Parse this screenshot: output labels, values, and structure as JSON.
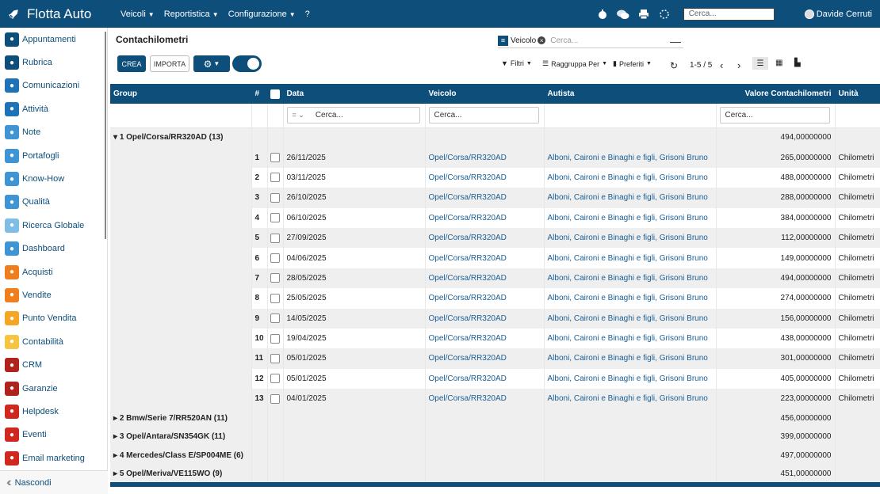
{
  "app": {
    "title": "Flotta Auto"
  },
  "topbar": {
    "menus": [
      {
        "label": "Veicoli"
      },
      {
        "label": "Reportistica"
      },
      {
        "label": "Configurazione"
      },
      {
        "label": "?"
      }
    ],
    "search_placeholder": "Cerca...",
    "user": "Davide Cerruti"
  },
  "sidebar": {
    "items": [
      {
        "label": "Appuntamenti",
        "color": "#0d4e7b",
        "icon": "calendar-icon"
      },
      {
        "label": "Rubrica",
        "color": "#0d4e7b",
        "icon": "contacts-icon"
      },
      {
        "label": "Comunicazioni",
        "color": "#1e73b8",
        "icon": "chat-icon"
      },
      {
        "label": "Attività",
        "color": "#1e73b8",
        "icon": "checkbox-icon"
      },
      {
        "label": "Note",
        "color": "#3f95d3",
        "icon": "note-icon"
      },
      {
        "label": "Portafogli",
        "color": "#3f95d3",
        "icon": "wallet-icon"
      },
      {
        "label": "Know-How",
        "color": "#3f95d3",
        "icon": "lightbulb-icon"
      },
      {
        "label": "Qualità",
        "color": "#3f95d3",
        "icon": "clock-icon"
      },
      {
        "label": "Ricerca Globale",
        "color": "#7fbde6",
        "icon": "search-icon"
      },
      {
        "label": "Dashboard",
        "color": "#3f95d3",
        "icon": "dashboard-icon"
      },
      {
        "label": "Acquisti",
        "color": "#f07e1c",
        "icon": "cart-icon"
      },
      {
        "label": "Vendite",
        "color": "#f07e1c",
        "icon": "chart-icon"
      },
      {
        "label": "Punto Vendita",
        "color": "#f5a623",
        "icon": "register-icon"
      },
      {
        "label": "Contabilità",
        "color": "#f5c542",
        "icon": "ledger-icon"
      },
      {
        "label": "CRM",
        "color": "#b0221c",
        "icon": "handshake-icon"
      },
      {
        "label": "Garanzie",
        "color": "#b0221c",
        "icon": "shield-icon"
      },
      {
        "label": "Helpdesk",
        "color": "#d0281e",
        "icon": "headset-icon"
      },
      {
        "label": "Eventi",
        "color": "#d0281e",
        "icon": "ticket-icon"
      },
      {
        "label": "Email marketing",
        "color": "#d0281e",
        "icon": "send-icon"
      }
    ],
    "hide_label": "Nascondi"
  },
  "control": {
    "title": "Contachilometri",
    "create_label": "CREA",
    "import_label": "IMPORTA",
    "search_facet": "Veicolo",
    "search_placeholder": "Cerca...",
    "filters_label": "Filtri",
    "groupby_label": "Raggruppa Per",
    "favorites_label": "Preferiti",
    "pager": "1-5 / 5"
  },
  "table": {
    "headers": {
      "group": "Group",
      "num": "#",
      "date": "Data",
      "vehicle": "Veicolo",
      "driver": "Autista",
      "value": "Valore Contachilometri",
      "unit": "Unità"
    },
    "filter": {
      "date_op": "=",
      "placeholder": "Cerca..."
    },
    "open_group": {
      "label": "1 Opel/Corsa/RR320AD (13)",
      "total": "494,00000000"
    },
    "rows": [
      {
        "n": "1",
        "date": "26/11/2025",
        "vehicle": "Opel/Corsa/RR320AD",
        "driver": "Alboni, Caironi e Binaghi e figli, Grisoni Bruno",
        "value": "265,00000000",
        "unit": "Chilometri"
      },
      {
        "n": "2",
        "date": "03/11/2025",
        "vehicle": "Opel/Corsa/RR320AD",
        "driver": "Alboni, Caironi e Binaghi e figli, Grisoni Bruno",
        "value": "488,00000000",
        "unit": "Chilometri"
      },
      {
        "n": "3",
        "date": "26/10/2025",
        "vehicle": "Opel/Corsa/RR320AD",
        "driver": "Alboni, Caironi e Binaghi e figli, Grisoni Bruno",
        "value": "288,00000000",
        "unit": "Chilometri"
      },
      {
        "n": "4",
        "date": "06/10/2025",
        "vehicle": "Opel/Corsa/RR320AD",
        "driver": "Alboni, Caironi e Binaghi e figli, Grisoni Bruno",
        "value": "384,00000000",
        "unit": "Chilometri"
      },
      {
        "n": "5",
        "date": "27/09/2025",
        "vehicle": "Opel/Corsa/RR320AD",
        "driver": "Alboni, Caironi e Binaghi e figli, Grisoni Bruno",
        "value": "112,00000000",
        "unit": "Chilometri"
      },
      {
        "n": "6",
        "date": "04/06/2025",
        "vehicle": "Opel/Corsa/RR320AD",
        "driver": "Alboni, Caironi e Binaghi e figli, Grisoni Bruno",
        "value": "149,00000000",
        "unit": "Chilometri"
      },
      {
        "n": "7",
        "date": "28/05/2025",
        "vehicle": "Opel/Corsa/RR320AD",
        "driver": "Alboni, Caironi e Binaghi e figli, Grisoni Bruno",
        "value": "494,00000000",
        "unit": "Chilometri"
      },
      {
        "n": "8",
        "date": "25/05/2025",
        "vehicle": "Opel/Corsa/RR320AD",
        "driver": "Alboni, Caironi e Binaghi e figli, Grisoni Bruno",
        "value": "274,00000000",
        "unit": "Chilometri"
      },
      {
        "n": "9",
        "date": "14/05/2025",
        "vehicle": "Opel/Corsa/RR320AD",
        "driver": "Alboni, Caironi e Binaghi e figli, Grisoni Bruno",
        "value": "156,00000000",
        "unit": "Chilometri"
      },
      {
        "n": "10",
        "date": "19/04/2025",
        "vehicle": "Opel/Corsa/RR320AD",
        "driver": "Alboni, Caironi e Binaghi e figli, Grisoni Bruno",
        "value": "438,00000000",
        "unit": "Chilometri"
      },
      {
        "n": "11",
        "date": "05/01/2025",
        "vehicle": "Opel/Corsa/RR320AD",
        "driver": "Alboni, Caironi e Binaghi e figli, Grisoni Bruno",
        "value": "301,00000000",
        "unit": "Chilometri"
      },
      {
        "n": "12",
        "date": "05/01/2025",
        "vehicle": "Opel/Corsa/RR320AD",
        "driver": "Alboni, Caironi e Binaghi e figli, Grisoni Bruno",
        "value": "405,00000000",
        "unit": "Chilometri"
      },
      {
        "n": "13",
        "date": "04/01/2025",
        "vehicle": "Opel/Corsa/RR320AD",
        "driver": "Alboni, Caironi e Binaghi e figli, Grisoni Bruno",
        "value": "223,00000000",
        "unit": "Chilometri"
      }
    ],
    "closed_groups": [
      {
        "label": "2 Bmw/Serie 7/RR520AN (11)",
        "total": "456,00000000"
      },
      {
        "label": "3 Opel/Antara/SN354GK (11)",
        "total": "399,00000000"
      },
      {
        "label": "4 Mercedes/Class E/SP004ME (6)",
        "total": "497,00000000"
      },
      {
        "label": "5 Opel/Meriva/VE115WO (9)",
        "total": "451,00000000"
      }
    ]
  }
}
